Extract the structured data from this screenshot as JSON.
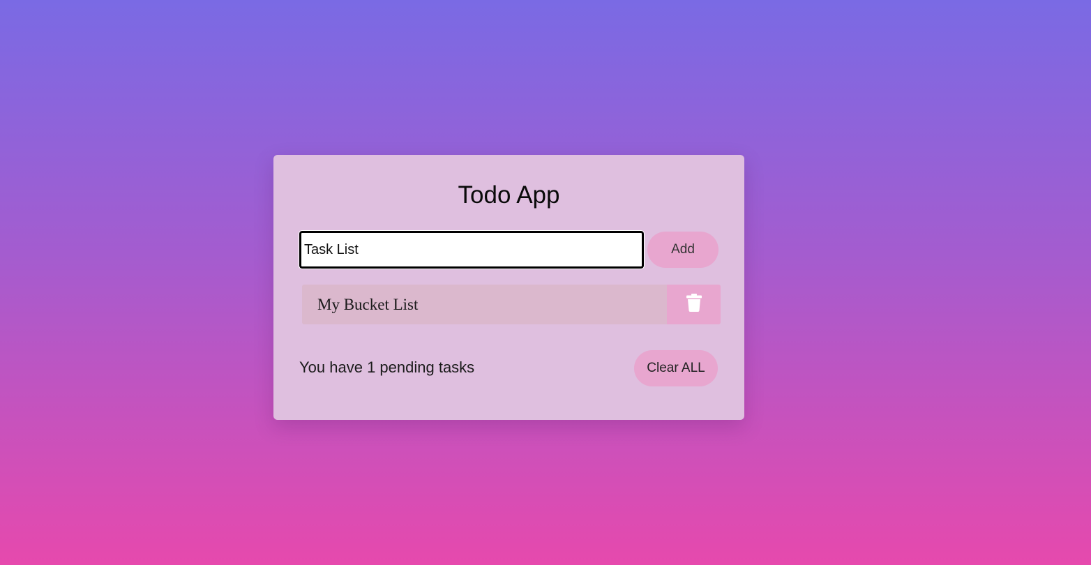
{
  "app": {
    "title": "Todo App"
  },
  "input": {
    "value": "Task List",
    "add_label": "Add"
  },
  "todos": [
    {
      "text": "My Bucket List",
      "delete_icon": "trash-icon"
    }
  ],
  "footer": {
    "prefix": "You have ",
    "pending_count": "1",
    "suffix": " pending tasks",
    "clear_label": "Clear ALL"
  },
  "colors": {
    "gradient_top": "#7a6ae4",
    "gradient_bottom": "#e649ad",
    "card": "#dfbfdf",
    "button": "#e8a6cf",
    "item": "#dbb8cd"
  }
}
